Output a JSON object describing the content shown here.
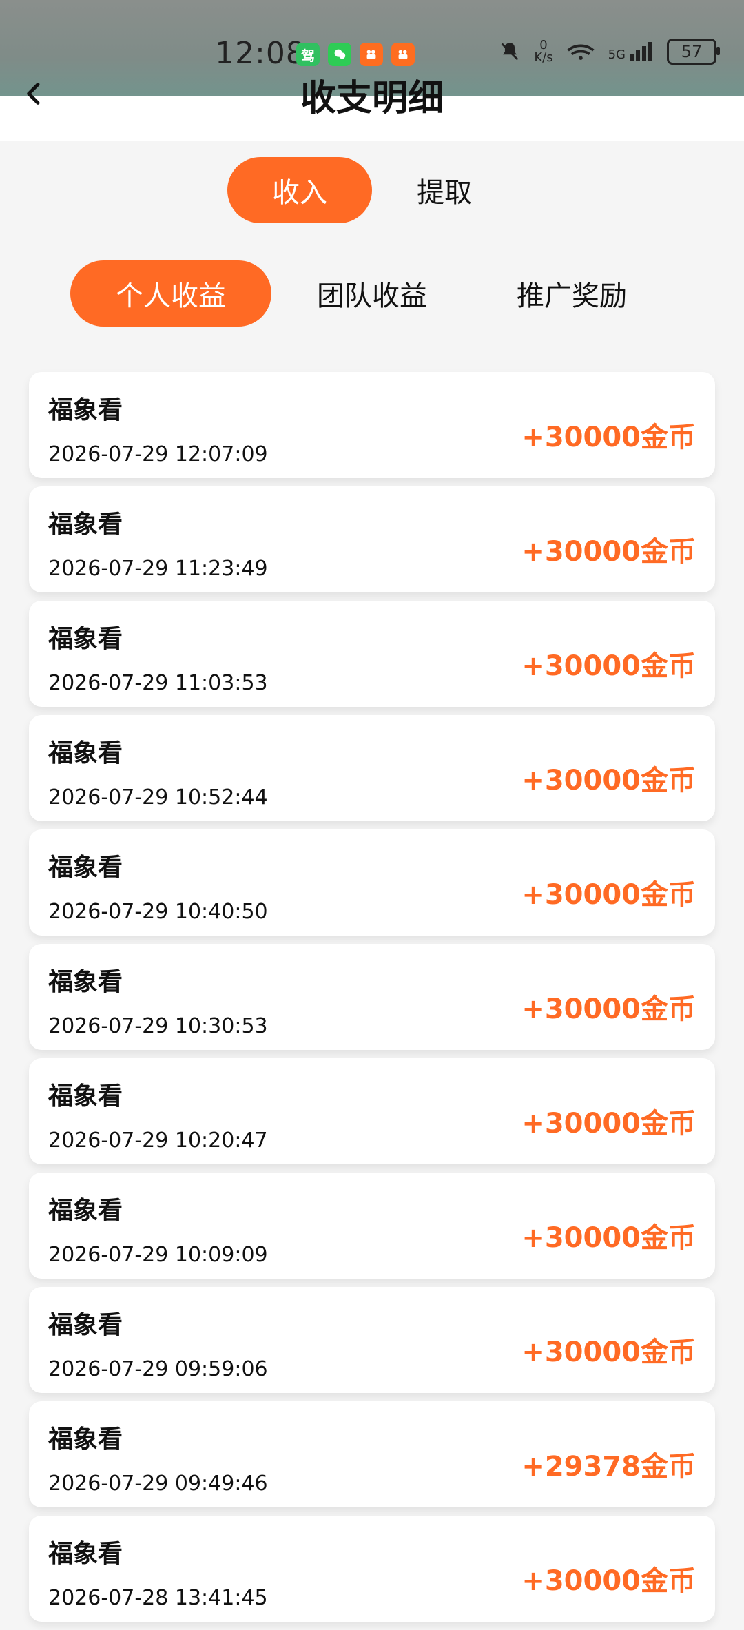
{
  "status": {
    "time": "12:08",
    "net_speed_value": "0",
    "net_speed_unit": "K/s",
    "network": "5G",
    "battery": "57"
  },
  "header": {
    "title": "收支明细"
  },
  "tabs": {
    "income": "收入",
    "withdraw": "提取"
  },
  "sub_tabs": {
    "personal": "个人收益",
    "team": "团队收益",
    "promo": "推广奖励"
  },
  "records": [
    {
      "title": "福象看",
      "time": "2026-07-29 12:07:09",
      "amount": "+30000金币"
    },
    {
      "title": "福象看",
      "time": "2026-07-29 11:23:49",
      "amount": "+30000金币"
    },
    {
      "title": "福象看",
      "time": "2026-07-29 11:03:53",
      "amount": "+30000金币"
    },
    {
      "title": "福象看",
      "time": "2026-07-29 10:52:44",
      "amount": "+30000金币"
    },
    {
      "title": "福象看",
      "time": "2026-07-29 10:40:50",
      "amount": "+30000金币"
    },
    {
      "title": "福象看",
      "time": "2026-07-29 10:30:53",
      "amount": "+30000金币"
    },
    {
      "title": "福象看",
      "time": "2026-07-29 10:20:47",
      "amount": "+30000金币"
    },
    {
      "title": "福象看",
      "time": "2026-07-29 10:09:09",
      "amount": "+30000金币"
    },
    {
      "title": "福象看",
      "time": "2026-07-29 09:59:06",
      "amount": "+30000金币"
    },
    {
      "title": "福象看",
      "time": "2026-07-29 09:49:46",
      "amount": "+29378金币"
    },
    {
      "title": "福象看",
      "time": "2026-07-28 13:41:45",
      "amount": "+30000金币"
    }
  ],
  "colors": {
    "accent": "#ff6a24"
  }
}
